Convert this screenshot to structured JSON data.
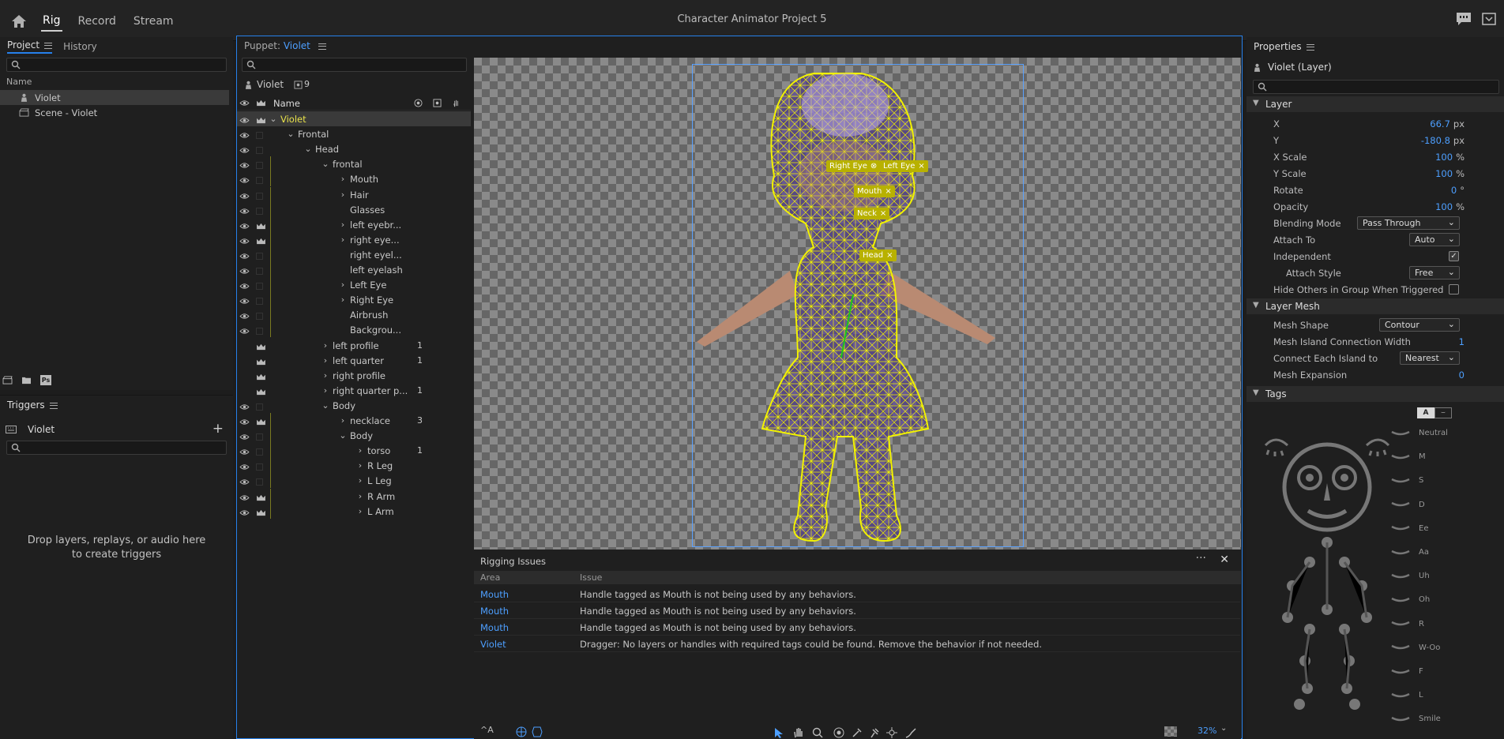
{
  "app": {
    "title": "Character Animator Project 5",
    "nav": [
      "Rig",
      "Record",
      "Stream"
    ],
    "active_nav": "Rig"
  },
  "project_panel": {
    "tabs": [
      "Project",
      "History"
    ],
    "column": "Name",
    "items": [
      "Violet",
      "Scene - Violet"
    ]
  },
  "triggers_panel": {
    "title": "Triggers",
    "puppet": "Violet",
    "drop_text": "Drop layers, replays, or audio here to create triggers"
  },
  "puppet_panel": {
    "label": "Puppet:",
    "puppet_name": "Violet",
    "puppet_root": "Violet",
    "count": "9",
    "name_header": "Name",
    "layers": [
      {
        "name": "Violet",
        "indent": 0,
        "chev": "v",
        "crown": true,
        "selected": true,
        "num": ""
      },
      {
        "name": "Frontal",
        "indent": 1,
        "chev": "v",
        "crown": false,
        "num": ""
      },
      {
        "name": "Head",
        "indent": 2,
        "chev": "v",
        "crown": false,
        "num": ""
      },
      {
        "name": "frontal",
        "indent": 3,
        "chev": "v",
        "crown": false,
        "num": ""
      },
      {
        "name": "Mouth",
        "indent": 4,
        "chev": ">",
        "crown": false,
        "num": ""
      },
      {
        "name": "Hair",
        "indent": 4,
        "chev": ">",
        "crown": false,
        "num": ""
      },
      {
        "name": "Glasses",
        "indent": 4,
        "chev": "",
        "crown": false,
        "num": ""
      },
      {
        "name": "left eyebr...",
        "indent": 4,
        "chev": ">",
        "crown": true,
        "num": ""
      },
      {
        "name": "right eye...",
        "indent": 4,
        "chev": ">",
        "crown": true,
        "num": ""
      },
      {
        "name": "right eyel...",
        "indent": 4,
        "chev": "",
        "crown": false,
        "num": ""
      },
      {
        "name": "left eyelash",
        "indent": 4,
        "chev": "",
        "crown": false,
        "num": ""
      },
      {
        "name": "Left Eye",
        "indent": 4,
        "chev": ">",
        "crown": false,
        "num": ""
      },
      {
        "name": "Right Eye",
        "indent": 4,
        "chev": ">",
        "crown": false,
        "num": ""
      },
      {
        "name": "Airbrush",
        "indent": 4,
        "chev": "",
        "crown": false,
        "num": ""
      },
      {
        "name": "Backgrou...",
        "indent": 4,
        "chev": "",
        "crown": false,
        "num": ""
      },
      {
        "name": "left profile",
        "indent": 3,
        "chev": ">",
        "crown": true,
        "num": "1"
      },
      {
        "name": "left quarter",
        "indent": 3,
        "chev": ">",
        "crown": true,
        "num": "1"
      },
      {
        "name": "right profile",
        "indent": 3,
        "chev": ">",
        "crown": true,
        "num": ""
      },
      {
        "name": "right quarter p...",
        "indent": 3,
        "chev": ">",
        "crown": true,
        "num": "1"
      },
      {
        "name": "Body",
        "indent": 3,
        "chev": "v",
        "crown": false,
        "num": ""
      },
      {
        "name": "necklace",
        "indent": 4,
        "chev": ">",
        "crown": true,
        "num": "3"
      },
      {
        "name": "Body",
        "indent": 4,
        "chev": "v",
        "crown": false,
        "num": ""
      },
      {
        "name": "torso",
        "indent": 5,
        "chev": ">",
        "crown": false,
        "num": "1"
      },
      {
        "name": "R Leg",
        "indent": 5,
        "chev": ">",
        "crown": false,
        "num": ""
      },
      {
        "name": "L Leg",
        "indent": 5,
        "chev": ">",
        "crown": false,
        "num": ""
      },
      {
        "name": "R Arm",
        "indent": 5,
        "chev": ">",
        "crown": true,
        "num": ""
      },
      {
        "name": "L Arm",
        "indent": 5,
        "chev": ">",
        "crown": true,
        "num": ""
      }
    ]
  },
  "canvas": {
    "handles": [
      "Right Eye",
      "Left Eye",
      "Mouth",
      "Neck",
      "Head"
    ],
    "zoom": "32%"
  },
  "rigging_issues": {
    "title": "Rigging Issues",
    "columns": [
      "Area",
      "Issue"
    ],
    "rows": [
      {
        "area": "Mouth",
        "issue": "Handle tagged as Mouth is not being used by any behaviors."
      },
      {
        "area": "Mouth",
        "issue": "Handle tagged as Mouth is not being used by any behaviors."
      },
      {
        "area": "Mouth",
        "issue": "Handle tagged as Mouth is not being used by any behaviors."
      },
      {
        "area": "Violet",
        "issue": "Dragger: No layers or handles with required tags could be found. Remove the behavior if not needed."
      }
    ]
  },
  "properties": {
    "title": "Properties",
    "layer_name": "Violet (Layer)",
    "layer_section": "Layer",
    "x_label": "X",
    "x_val": "66.7",
    "x_unit": "px",
    "y_label": "Y",
    "y_val": "-180.8",
    "y_unit": "px",
    "xscale_label": "X Scale",
    "xscale_val": "100",
    "xscale_unit": "%",
    "yscale_label": "Y Scale",
    "yscale_val": "100",
    "yscale_unit": "%",
    "rotate_label": "Rotate",
    "rotate_val": "0",
    "rotate_unit": "°",
    "opacity_label": "Opacity",
    "opacity_val": "100",
    "opacity_unit": "%",
    "blend_label": "Blending Mode",
    "blend_val": "Pass Through",
    "attach_label": "Attach To",
    "attach_val": "Auto",
    "independent_label": "Independent",
    "independent": true,
    "attachstyle_label": "Attach Style",
    "attachstyle_val": "Free",
    "hide_label": "Hide Others in Group When Triggered",
    "hide": false,
    "mesh_section": "Layer Mesh",
    "meshshape_label": "Mesh Shape",
    "meshshape_val": "Contour",
    "island_label": "Mesh Island Connection Width",
    "island_val": "1",
    "connect_label": "Connect Each Island to",
    "connect_val": "Nearest",
    "expansion_label": "Mesh Expansion",
    "expansion_val": "0",
    "tags_section": "Tags",
    "tags": [
      "Neutral",
      "M",
      "S",
      "D",
      "Ee",
      "Aa",
      "Uh",
      "Oh",
      "R",
      "W-Oo",
      "F",
      "L",
      "Smile"
    ]
  },
  "colors": {
    "accent": "#2680eb",
    "mesh": "#f2f200",
    "handle": "#b8b100",
    "link": "#4d9fff"
  }
}
